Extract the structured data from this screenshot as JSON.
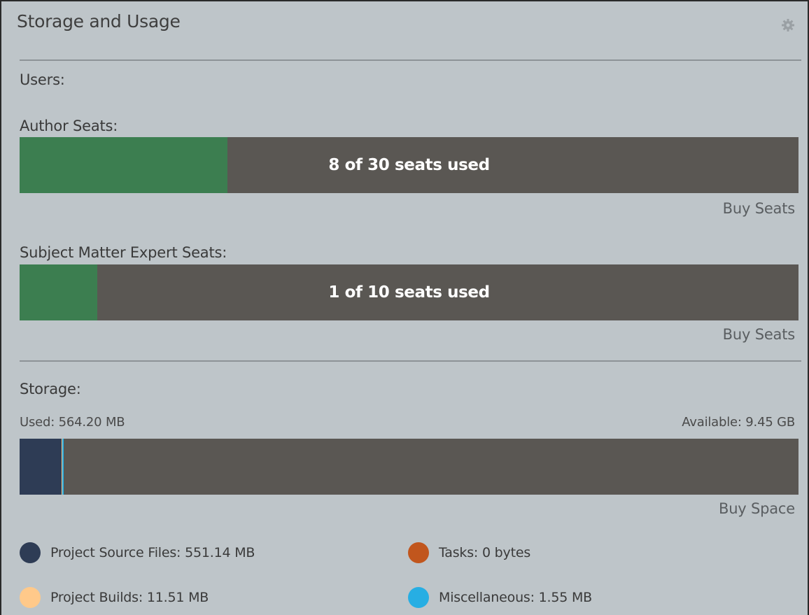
{
  "panel": {
    "title": "Storage and Usage",
    "settings_icon": "gear-icon"
  },
  "users": {
    "heading": "Users:",
    "author": {
      "label": "Author Seats:",
      "used": 8,
      "total": 30,
      "text": "8 of 30 seats used",
      "buy_label": "Buy Seats"
    },
    "sme": {
      "label": "Subject Matter Expert Seats:",
      "used": 1,
      "total": 10,
      "text": "1 of 10 seats used",
      "buy_label": "Buy Seats"
    },
    "fill_color": "#3c7e50"
  },
  "storage": {
    "heading": "Storage:",
    "used_text": "Used: 564.20 MB",
    "available_text": "Available: 9.45 GB",
    "buy_label": "Buy Space",
    "segments": [
      {
        "name": "project-source-files",
        "fraction": 0.054,
        "color": "#2e3c55"
      },
      {
        "name": "project-builds",
        "fraction": 0.0012,
        "color": "#ffc98a"
      },
      {
        "name": "tasks",
        "fraction": 0,
        "color": "#c1561d"
      },
      {
        "name": "miscellaneous",
        "fraction": 0.0002,
        "color": "#27aee3"
      }
    ],
    "legend": [
      {
        "label": "Project Source Files: 551.14 MB",
        "color": "#2e3c55"
      },
      {
        "label": "Tasks: 0 bytes",
        "color": "#c1561d"
      },
      {
        "label": "Project Builds: 11.51 MB",
        "color": "#ffc98a"
      },
      {
        "label": "Miscellaneous: 1.55 MB",
        "color": "#27aee3"
      }
    ]
  }
}
